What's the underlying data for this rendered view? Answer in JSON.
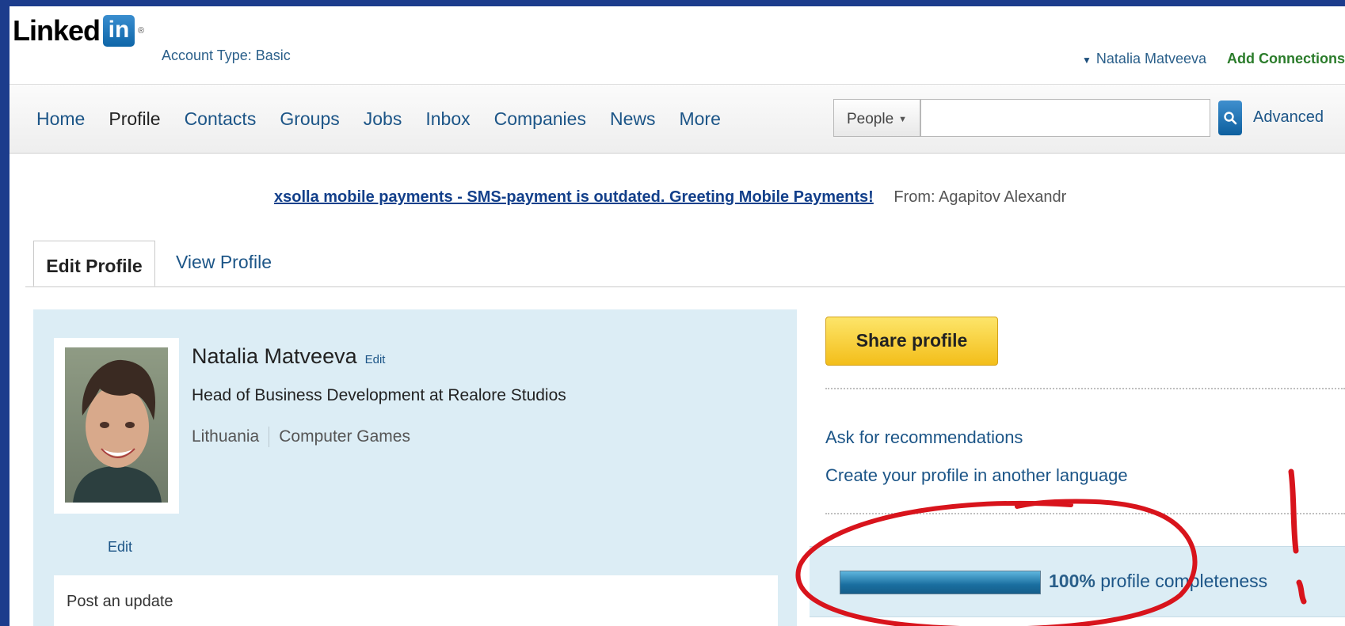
{
  "header": {
    "logo_text": "Linked",
    "logo_in": "in",
    "logo_reg": "®",
    "account_type": "Account Type: Basic",
    "user_name": "Natalia Matveeva",
    "add_connections": "Add Connections"
  },
  "nav": {
    "items": [
      "Home",
      "Profile",
      "Contacts",
      "Groups",
      "Jobs",
      "Inbox",
      "Companies",
      "News",
      "More"
    ],
    "active": "Profile"
  },
  "search": {
    "category": "People",
    "value": "",
    "advanced": "Advanced"
  },
  "ad": {
    "link": "xsolla mobile payments - SMS-payment is outdated. Greeting Mobile Payments!",
    "from": "From:  Agapitov Alexandr"
  },
  "tabs": {
    "edit": "Edit Profile",
    "view": "View Profile"
  },
  "profile": {
    "name": "Natalia Matveeva",
    "name_edit": "Edit",
    "headline": "Head of Business Development at Realore Studios",
    "location": "Lithuania",
    "industry": "Computer Games",
    "photo_edit": "Edit",
    "post_update": "Post an update"
  },
  "sidebar": {
    "share_profile": "Share profile",
    "ask_recommendations": "Ask for recommendations",
    "create_language": "Create your profile in another language",
    "completeness_percent": "100%",
    "completeness_label": "profile completeness",
    "completeness_value": 100
  },
  "colors": {
    "link": "#1c5587",
    "highlight_panel": "#dcedf5",
    "share_button": "#f5c527",
    "annotation": "#d8141c"
  }
}
